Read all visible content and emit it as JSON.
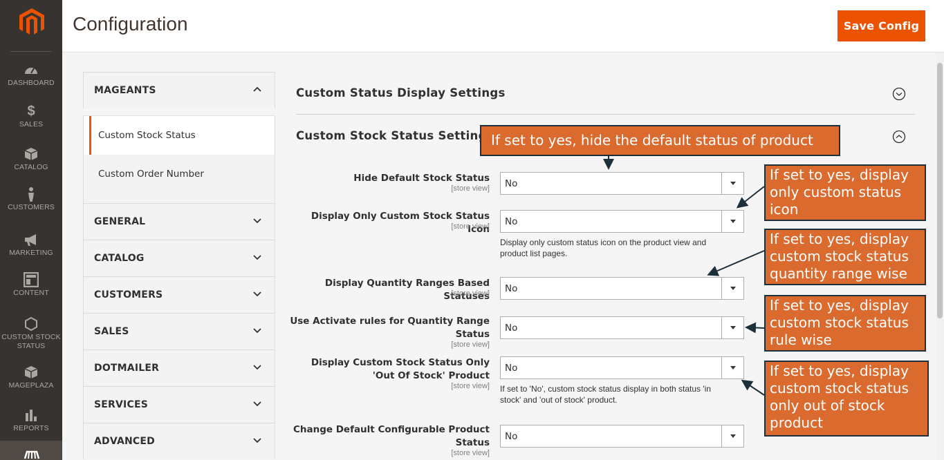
{
  "header": {
    "title": "Configuration",
    "save_label": "Save Config"
  },
  "nav": {
    "items": [
      {
        "label": "DASHBOARD",
        "icon": "dashboard-icon"
      },
      {
        "label": "SALES",
        "icon": "dollar-icon"
      },
      {
        "label": "CATALOG",
        "icon": "box-icon"
      },
      {
        "label": "CUSTOMERS",
        "icon": "person-icon"
      },
      {
        "label": "MARKETING",
        "icon": "megaphone-icon"
      },
      {
        "label": "CONTENT",
        "icon": "layout-icon"
      },
      {
        "label": "CUSTOM STOCK STATUS",
        "icon": "hexagon-icon"
      },
      {
        "label": "MAGEPLAZA",
        "icon": "box-icon"
      },
      {
        "label": "REPORTS",
        "icon": "bar-chart-icon"
      }
    ]
  },
  "tabs": {
    "mageants": "MAGEANTS",
    "sub": [
      "Custom Stock Status",
      "Custom Order Number"
    ],
    "groups": [
      "GENERAL",
      "CATALOG",
      "CUSTOMERS",
      "SALES",
      "DOTMAILER",
      "SERVICES",
      "ADVANCED"
    ]
  },
  "sections": {
    "display": "Custom Status Display Settings",
    "stock": "Custom Stock Status Settings"
  },
  "fields": [
    {
      "label": "Hide Default Stock Status",
      "scope": "[store view]",
      "value": "No"
    },
    {
      "label": "Display Only Custom Stock Status Icon",
      "scope": "[store view]",
      "value": "No",
      "note": "Display only custom status icon on the product view and product list pages."
    },
    {
      "label": "Display Quantity Ranges Based Statuses",
      "scope": "[store view]",
      "value": "No"
    },
    {
      "label": "Use Activate rules for Quantity Range Status",
      "scope": "[store view]",
      "value": "No"
    },
    {
      "label": "Display Custom Stock Status Only 'Out Of Stock' Product",
      "scope": "[store view]",
      "value": "No",
      "note": "If set to 'No', custom stock status display in both status 'in stock' and 'out of stock' product."
    },
    {
      "label": "Change Default Configurable Product Status",
      "scope": "[store view]",
      "value": "No"
    }
  ],
  "callouts": [
    "If set to yes, hide the default status of product",
    "If set to yes, display only custom status icon",
    "If set to yes, display custom stock status quantity range wise",
    "If set to yes, display custom stock status rule wise",
    "If set to yes, display custom stock status only out of stock product"
  ],
  "colors": {
    "accent": "#eb5202",
    "nav_bg": "#373330",
    "callout_bg": "#db6a2f",
    "callout_border": "#1e2f3c"
  }
}
